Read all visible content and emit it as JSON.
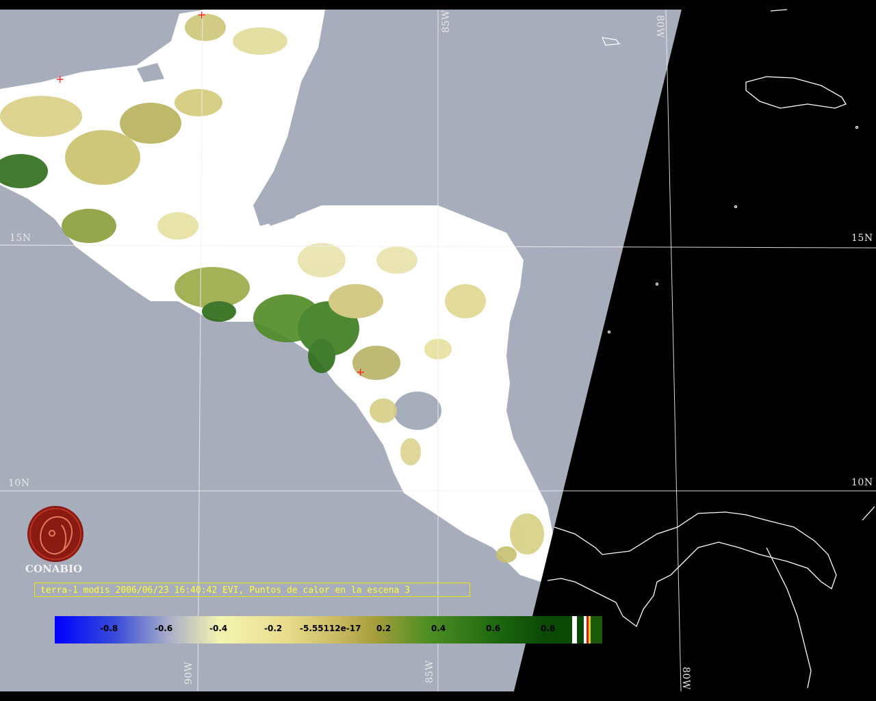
{
  "caption": "terra-1 modis 2006/06/23 16:40:42 EVI, Puntos de calor en la escena 3",
  "logo": {
    "text": "CONABIO"
  },
  "grid_labels": {
    "lon_85_top": "85W",
    "lon_80_top": "80W",
    "lon_90_bottom": "90W",
    "lon_85_bottom": "85W",
    "lon_80_bottom": "80W",
    "lat_15_left": "15N",
    "lat_15_right": "15N",
    "lat_10_left": "10N",
    "lat_10_right": "10N"
  },
  "colorbar": {
    "ticks": [
      "-0.8",
      "-0.6",
      "-0.4",
      "-0.2",
      "-5.55112e-17",
      "0.2",
      "0.4",
      "0.6",
      "0.8"
    ]
  },
  "colors": {
    "ocean": "#a8adbc",
    "land_cloud": "#ffffff",
    "no_data": "#000000",
    "coastline": "#ffffff",
    "caption_text": "#ffff33",
    "hotspot": "#ff2020",
    "logo": "#8b1a12"
  },
  "icons": {
    "hotspot_marker": "red-cross",
    "logo_mark": "conabio-logo"
  }
}
